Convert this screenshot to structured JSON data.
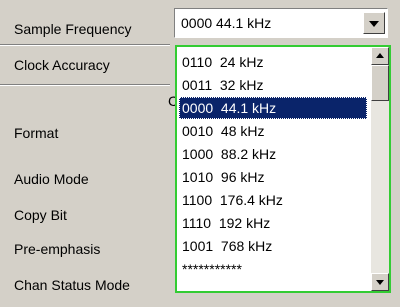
{
  "rows": {
    "sample_frequency": "Sample Frequency",
    "clock_accuracy": "Clock Accuracy",
    "cut_char": "C",
    "format": "Format",
    "audio_mode": "Audio Mode",
    "copy_bit": "Copy Bit",
    "pre_emphasis": "Pre-emphasis",
    "chan_status_mode": "Chan Status Mode"
  },
  "combo": {
    "value": "0000  44.1 kHz"
  },
  "list": {
    "items": [
      "0110  24 kHz",
      "0011  32 kHz",
      "0000  44.1 kHz",
      "0010  48 kHz",
      "1000  88.2 kHz",
      "1010  96 kHz",
      "1100  176.4 kHz",
      "1110  192 kHz",
      "1001  768 kHz",
      "***********"
    ],
    "selected_index": 2
  },
  "icons": {
    "combo_dropdown": "chevron-down-icon",
    "scroll_up": "scroll-up-icon",
    "scroll_down": "scroll-down-icon"
  },
  "colors": {
    "panel": "#d4d0c8",
    "list_border": "#33cc33",
    "selection": "#0a246a"
  }
}
